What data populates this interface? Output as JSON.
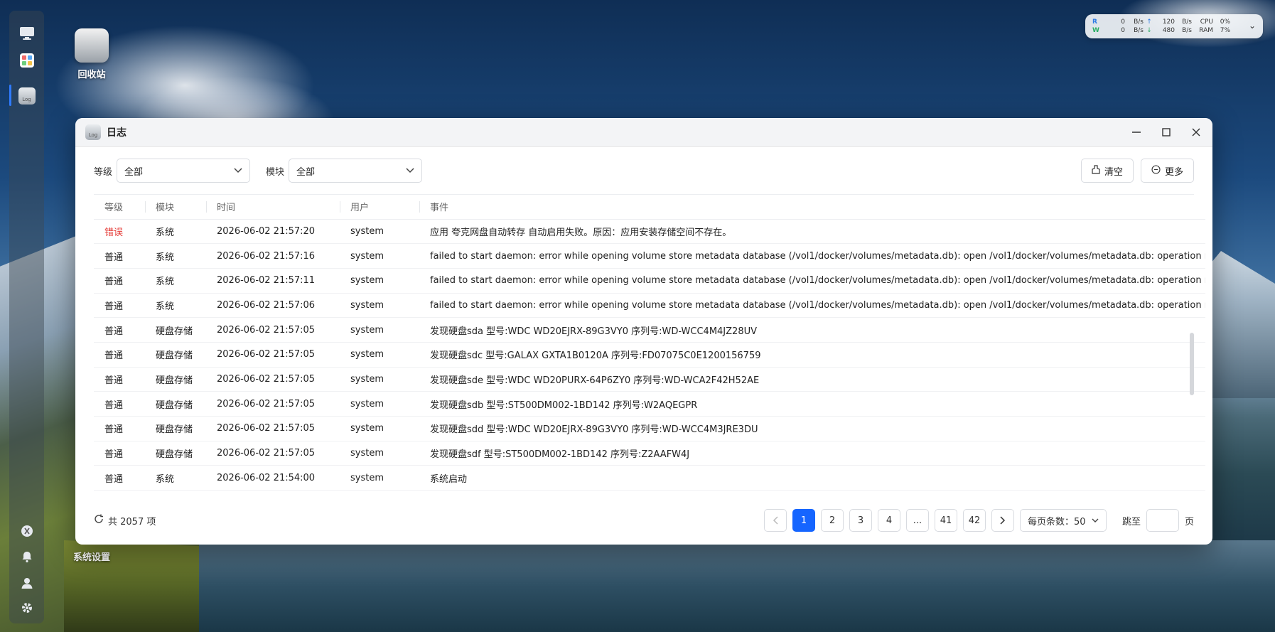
{
  "desktop": {
    "icons": [
      {
        "label": "回收站"
      },
      {
        "label": "系统设置"
      }
    ]
  },
  "dock": {
    "items": [
      "monitor-icon",
      "app-center-icon",
      "log-app-icon",
      "theme-icon",
      "bell-icon",
      "user-icon",
      "settings-icon"
    ],
    "log_badge_text": "Log"
  },
  "net_widget": {
    "r_label": "R",
    "r_val": "0",
    "r_unit": "B/s",
    "up_val": "120",
    "up_unit": "B/s",
    "cpu_label": "CPU",
    "cpu_val": "0%",
    "w_label": "W",
    "w_val": "0",
    "w_unit": "B/s",
    "down_val": "480",
    "down_unit": "B/s",
    "ram_label": "RAM",
    "ram_val": "7%"
  },
  "window": {
    "title": "日志",
    "filters": {
      "level_label": "等级",
      "level_value": "全部",
      "module_label": "模块",
      "module_value": "全部"
    },
    "buttons": {
      "clear": "清空",
      "more": "更多"
    },
    "columns": [
      "等级",
      "模块",
      "时间",
      "用户",
      "事件"
    ],
    "rows": [
      {
        "level": "错误",
        "module": "系统",
        "time": "2026-06-02 21:57:20",
        "user": "system",
        "event": "应用 夸克网盘自动转存 自动启用失败。原因：应用安装存储空间不存在。"
      },
      {
        "level": "普通",
        "module": "系统",
        "time": "2026-06-02 21:57:16",
        "user": "system",
        "event": "failed to start daemon: error while opening volume store metadata database (/vol1/docker/volumes/metadata.db): open /vol1/docker/volumes/metadata.db: operation not permitted"
      },
      {
        "level": "普通",
        "module": "系统",
        "time": "2026-06-02 21:57:11",
        "user": "system",
        "event": "failed to start daemon: error while opening volume store metadata database (/vol1/docker/volumes/metadata.db): open /vol1/docker/volumes/metadata.db: operation not permitted"
      },
      {
        "level": "普通",
        "module": "系统",
        "time": "2026-06-02 21:57:06",
        "user": "system",
        "event": "failed to start daemon: error while opening volume store metadata database (/vol1/docker/volumes/metadata.db): open /vol1/docker/volumes/metadata.db: operation not permitted"
      },
      {
        "level": "普通",
        "module": "硬盘存储",
        "time": "2026-06-02 21:57:05",
        "user": "system",
        "event": "发现硬盘sda 型号:WDC WD20EJRX-89G3VY0 序列号:WD-WCC4M4JZ28UV"
      },
      {
        "level": "普通",
        "module": "硬盘存储",
        "time": "2026-06-02 21:57:05",
        "user": "system",
        "event": "发现硬盘sdc 型号:GALAX GXTA1B0120A 序列号:FD07075C0E1200156759"
      },
      {
        "level": "普通",
        "module": "硬盘存储",
        "time": "2026-06-02 21:57:05",
        "user": "system",
        "event": "发现硬盘sde 型号:WDC WD20PURX-64P6ZY0 序列号:WD-WCA2F42H52AE"
      },
      {
        "level": "普通",
        "module": "硬盘存储",
        "time": "2026-06-02 21:57:05",
        "user": "system",
        "event": "发现硬盘sdb 型号:ST500DM002-1BD142 序列号:W2AQEGPR"
      },
      {
        "level": "普通",
        "module": "硬盘存储",
        "time": "2026-06-02 21:57:05",
        "user": "system",
        "event": "发现硬盘sdd 型号:WDC WD20EJRX-89G3VY0 序列号:WD-WCC4M3JRE3DU"
      },
      {
        "level": "普通",
        "module": "硬盘存储",
        "time": "2026-06-02 21:57:05",
        "user": "system",
        "event": "发现硬盘sdf 型号:ST500DM002-1BD142 序列号:Z2AAFW4J"
      },
      {
        "level": "普通",
        "module": "系统",
        "time": "2026-06-02 21:54:00",
        "user": "system",
        "event": "系统启动"
      }
    ],
    "footer": {
      "total": "共 2057 项",
      "pages": [
        "1",
        "2",
        "3",
        "4",
        "...",
        "41",
        "42"
      ],
      "current_page": "1",
      "page_size": "每页条数：50",
      "jump_label": "跳至",
      "jump_suffix": "页"
    }
  },
  "colors": {
    "accent": "#1565ff",
    "error": "#e53935"
  }
}
